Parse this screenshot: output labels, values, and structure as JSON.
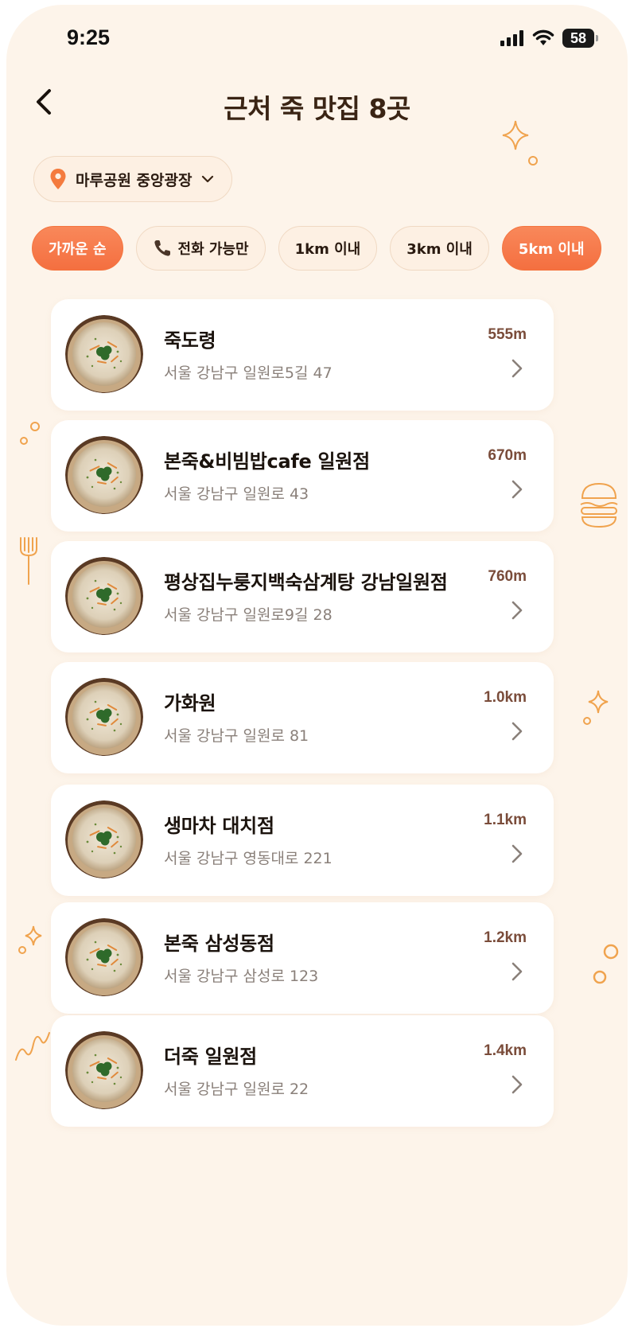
{
  "status_bar": {
    "time": "9:25",
    "battery": "58"
  },
  "header": {
    "title": "근처 죽 맛집 8곳"
  },
  "location": {
    "label": "마루공원 중앙광장"
  },
  "filters": [
    {
      "label": "가까운 순",
      "active": true
    },
    {
      "label": "전화 가능만",
      "active": false
    },
    {
      "label": "1km 이내",
      "active": false
    },
    {
      "label": "3km 이내",
      "active": false
    },
    {
      "label": "5km 이내",
      "active": true
    }
  ],
  "restaurants": [
    {
      "name": "죽도령",
      "address": "서울 강남구 일원로5길 47",
      "distance": "555m"
    },
    {
      "name": "본죽&비빔밥cafe 일원점",
      "address": "서울 강남구 일원로 43",
      "distance": "670m"
    },
    {
      "name": "평상집누룽지백숙삼계탕 강남일원점",
      "address": "서울 강남구 일원로9길 28",
      "distance": "760m"
    },
    {
      "name": "가화원",
      "address": "서울 강남구 일원로 81",
      "distance": "1.0km"
    },
    {
      "name": "생마차 대치점",
      "address": "서울 강남구 영동대로 221",
      "distance": "1.1km"
    },
    {
      "name": "본죽 삼성동점",
      "address": "서울 강남구 삼성로 123",
      "distance": "1.2km"
    },
    {
      "name": "더죽 일원점",
      "address": "서울 강남구 일원로 22",
      "distance": "1.4km"
    }
  ],
  "colors": {
    "accent": "#f4753f",
    "background": "#fdf4ea",
    "card": "#ffffff",
    "distance": "#7a4c3a"
  }
}
